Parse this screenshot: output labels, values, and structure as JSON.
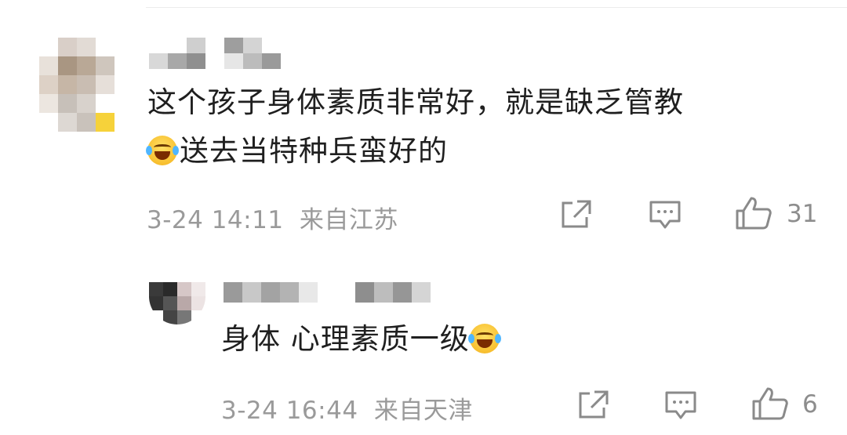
{
  "comment": {
    "text_line1": "这个孩子身体素质非常好，就是缺乏管教",
    "text_line2": "送去当特种兵蛮好的",
    "emoji_line2": "laughing-tears-emoji",
    "time": "3-24 14:11",
    "location": "来自江苏",
    "like_count": "31"
  },
  "reply": {
    "text": "身体 心理素质一级",
    "emoji": "laughing-tears-emoji",
    "time": "3-24 16:44",
    "location": "来自天津",
    "like_count": "6"
  },
  "icons": {
    "share": "share-icon",
    "comment": "comment-icon",
    "like": "thumbs-up-icon"
  },
  "colors": {
    "text": "#1f1f1f",
    "meta": "#9a9a9a",
    "icon": "#8a8a8a"
  }
}
